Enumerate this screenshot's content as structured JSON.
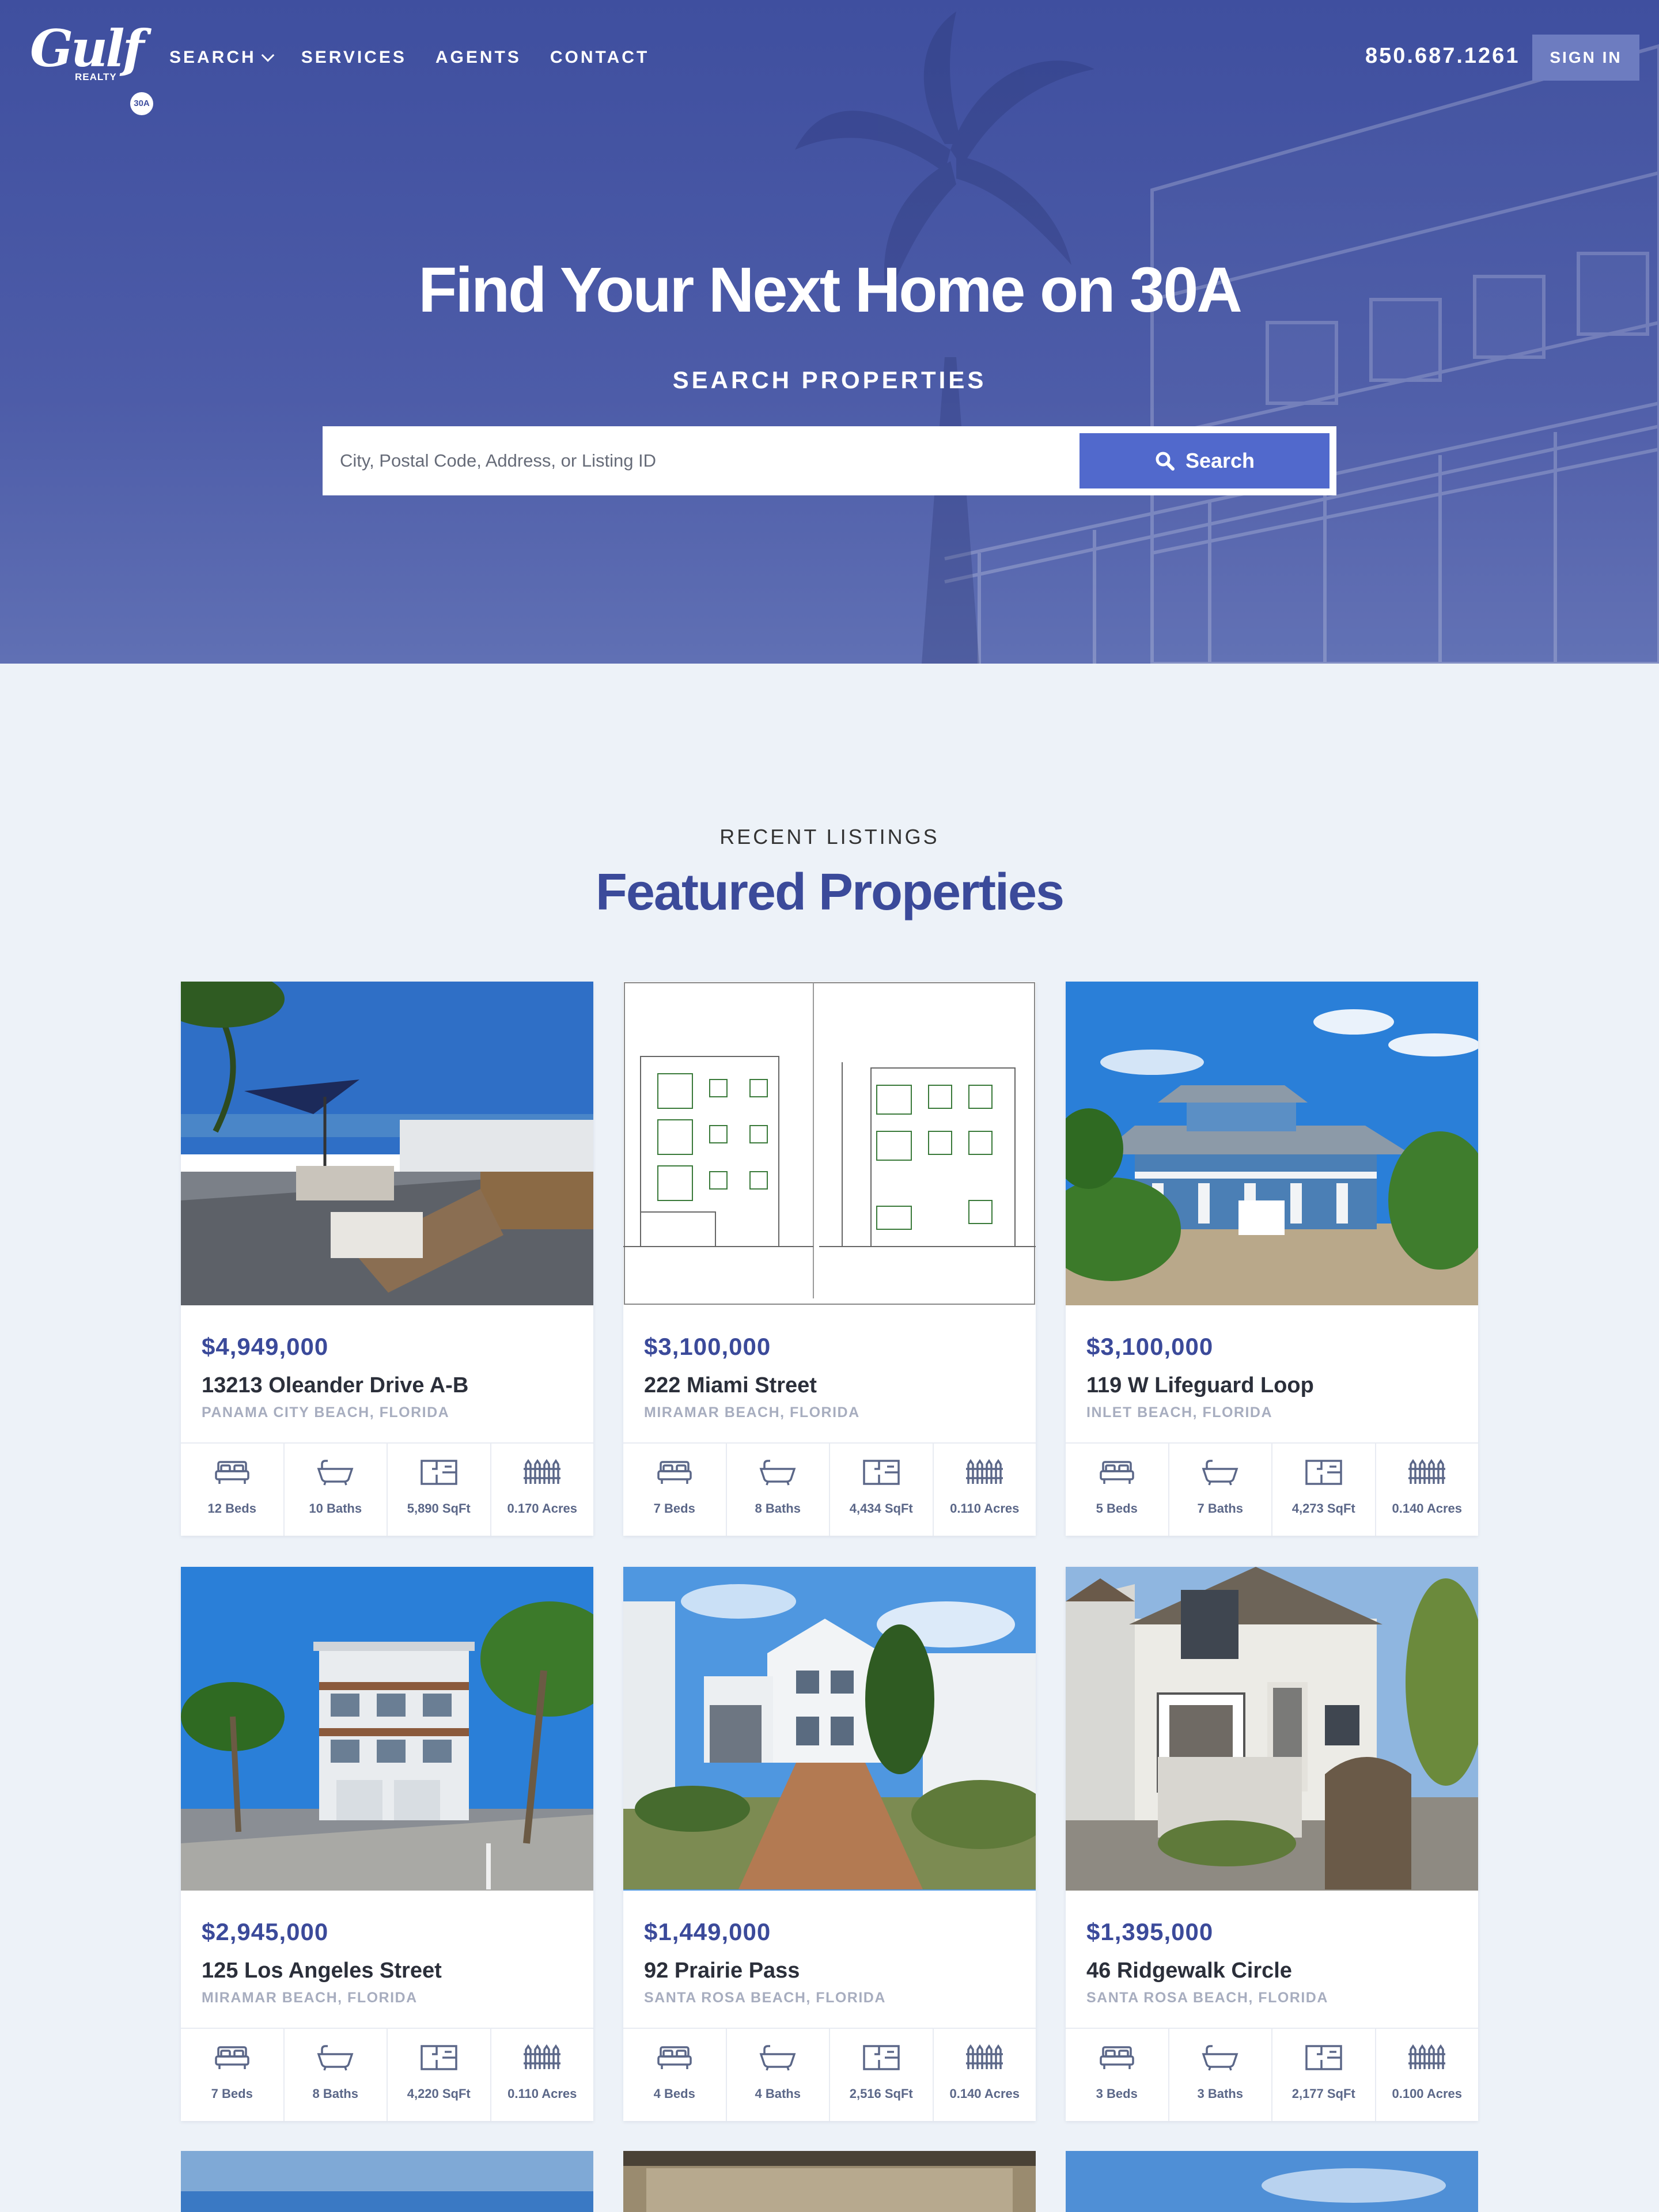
{
  "nav": {
    "logo_script": "Gulf",
    "logo_sub": "REALTY",
    "logo_badge": "30A",
    "links": [
      "SEARCH",
      "SERVICES",
      "AGENTS",
      "CONTACT"
    ],
    "phone": "850.687.1261",
    "signin_label": "SIGN IN"
  },
  "hero": {
    "title": "Find Your Next Home on 30A",
    "subtitle": "SEARCH PROPERTIES",
    "search_placeholder": "City, Postal Code, Address, or Listing ID",
    "search_button": "Search"
  },
  "listings": {
    "eyebrow": "RECENT LISTINGS",
    "title": "Featured Properties",
    "cards": [
      {
        "price": "$4,949,000",
        "address": "13213 Oleander Drive A-B",
        "city": "PANAMA CITY BEACH, FLORIDA",
        "beds": "12 Beds",
        "baths": "10 Baths",
        "sqft": "5,890 SqFt",
        "acres": "0.170 Acres"
      },
      {
        "price": "$3,100,000",
        "address": "222 Miami Street",
        "city": "MIRAMAR BEACH, FLORIDA",
        "beds": "7 Beds",
        "baths": "8 Baths",
        "sqft": "4,434 SqFt",
        "acres": "0.110 Acres"
      },
      {
        "price": "$3,100,000",
        "address": "119 W Lifeguard Loop",
        "city": "INLET BEACH, FLORIDA",
        "beds": "5 Beds",
        "baths": "7 Baths",
        "sqft": "4,273 SqFt",
        "acres": "0.140 Acres"
      },
      {
        "price": "$2,945,000",
        "address": "125 Los Angeles Street",
        "city": "MIRAMAR BEACH, FLORIDA",
        "beds": "7 Beds",
        "baths": "8 Baths",
        "sqft": "4,220 SqFt",
        "acres": "0.110 Acres"
      },
      {
        "price": "$1,449,000",
        "address": "92 Prairie Pass",
        "city": "SANTA ROSA BEACH, FLORIDA",
        "beds": "4 Beds",
        "baths": "4 Baths",
        "sqft": "2,516 SqFt",
        "acres": "0.140 Acres"
      },
      {
        "price": "$1,395,000",
        "address": "46 Ridgewalk Circle",
        "city": "SANTA ROSA BEACH, FLORIDA",
        "beds": "3 Beds",
        "baths": "3 Baths",
        "sqft": "2,177 SqFt",
        "acres": "0.100 Acres"
      }
    ]
  },
  "colors": {
    "hero_overlay": "#3f4f9f",
    "accent": "#5169cc",
    "title_blue": "#3b4a9a",
    "background": "#edf2f8",
    "muted": "#a7adbf"
  },
  "icons": [
    "search-icon",
    "chevron-down-icon",
    "bed-icon",
    "bathtub-icon",
    "floorplan-icon",
    "fence-icon"
  ]
}
